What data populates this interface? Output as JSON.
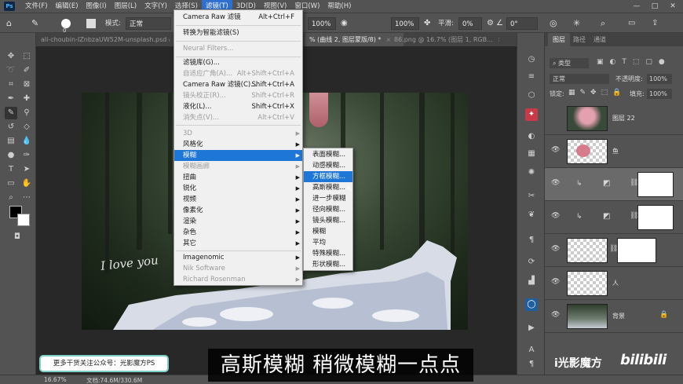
{
  "menubar": {
    "items": [
      "文件(F)",
      "编辑(E)",
      "图像(I)",
      "图层(L)",
      "文字(Y)",
      "选择(S)",
      "滤镜(T)",
      "3D(D)",
      "视图(V)",
      "窗口(W)",
      "帮助(H)"
    ],
    "active_index": 6,
    "minimize": "—",
    "maximize": "□",
    "close": "✕"
  },
  "options": {
    "brush_size": "0",
    "mode_label": "模式:",
    "mode_value": "正常",
    "opacity": "100%",
    "flow": "100%",
    "smooth_label": "平滑:",
    "smooth_value": "0%",
    "angle": "0°"
  },
  "tabs": [
    {
      "label": "ali-choubin-IZnbzaUW52M-unsplash.psd @ 1",
      "close": "×"
    },
    {
      "label": "% (曲线 2, 图层蒙版/8) *",
      "close": "×"
    },
    {
      "label": "86.png @ 16.7% (图层 1, RGB...",
      "close": "×"
    }
  ],
  "filter_menu": {
    "items": [
      {
        "label": "Camera Raw 滤镜",
        "shortcut": "Alt+Ctrl+F"
      },
      {
        "label": "转换为智能滤镜(S)"
      },
      {
        "label": "Neural Filters..."
      },
      {
        "label": "滤镜库(G)..."
      },
      {
        "label": "自适应广角(A)...",
        "shortcut": "Alt+Shift+Ctrl+A"
      },
      {
        "label": "Camera Raw 滤镜(C)...",
        "shortcut": "Shift+Ctrl+A"
      },
      {
        "label": "镜头校正(R)...",
        "shortcut": "Shift+Ctrl+R"
      },
      {
        "label": "液化(L)...",
        "shortcut": "Shift+Ctrl+X"
      },
      {
        "label": "消失点(V)...",
        "shortcut": "Alt+Ctrl+V"
      },
      {
        "label": "3D"
      },
      {
        "label": "风格化"
      },
      {
        "label": "模糊"
      },
      {
        "label": "模糊画廊"
      },
      {
        "label": "扭曲"
      },
      {
        "label": "锐化"
      },
      {
        "label": "视频"
      },
      {
        "label": "像素化"
      },
      {
        "label": "渲染"
      },
      {
        "label": "杂色"
      },
      {
        "label": "其它"
      },
      {
        "label": "Imagenomic"
      },
      {
        "label": "Nik Software"
      },
      {
        "label": "Richard Rosenman"
      }
    ],
    "arrow": "▶"
  },
  "blur_menu": {
    "items": [
      "表面模糊...",
      "动感模糊...",
      "方框模糊...",
      "高斯模糊...",
      "进一步模糊",
      "径向模糊...",
      "镜头模糊...",
      "模糊",
      "平均",
      "特殊模糊...",
      "形状模糊..."
    ]
  },
  "layers_panel": {
    "tabs": [
      "图层",
      "路径",
      "通道"
    ],
    "kind_label": "类型",
    "blend_mode": "正常",
    "opacity_label": "不透明度:",
    "opacity_value": "100%",
    "lock_label": "锁定:",
    "fill_label": "填充:",
    "fill_value": "100%",
    "layers": [
      {
        "name": "图层 22"
      },
      {
        "name": "鱼"
      },
      {
        "name": ""
      },
      {
        "name": ""
      },
      {
        "name": ""
      },
      {
        "name": "人"
      },
      {
        "name": "背景"
      }
    ]
  },
  "canvas": {
    "watermark_text": "I love you"
  },
  "status": {
    "zoom": "16.67%",
    "doc": "文档:74.6M/330.6M"
  },
  "overlay": {
    "subtitle": "高斯模糊 稍微模糊一点点",
    "promo": "更多干货关注公众号：光影魔方PS",
    "brand": "i光影魔方",
    "bilibili": "bilibili"
  }
}
